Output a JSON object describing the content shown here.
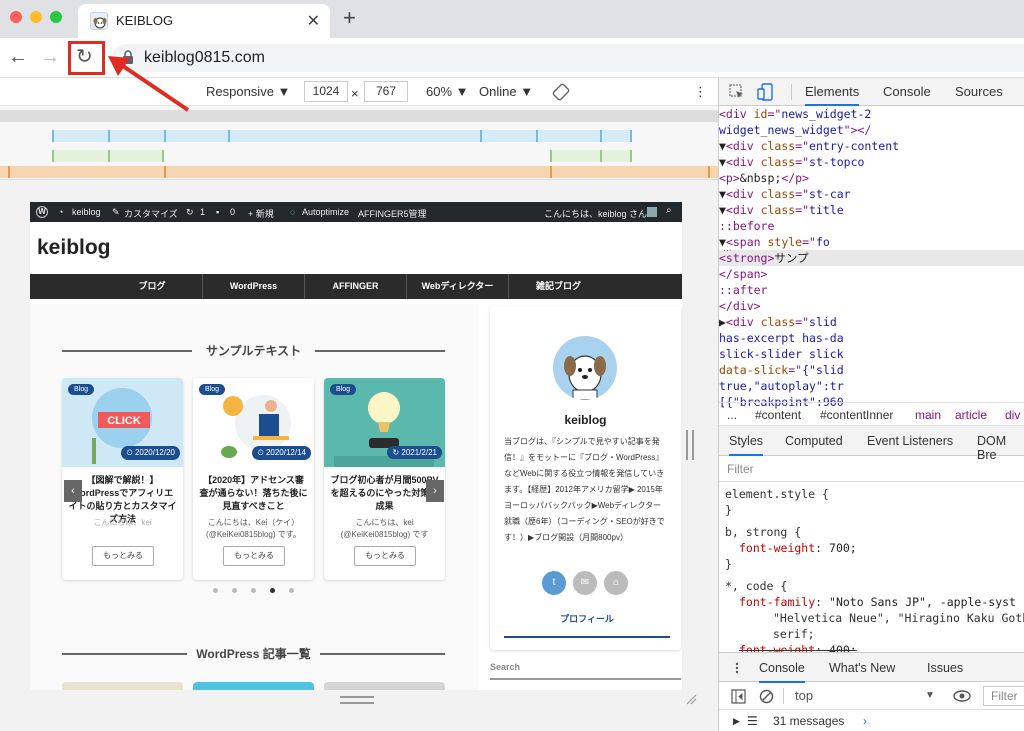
{
  "browser": {
    "tab_title": "KEIBLOG",
    "tab_close": "✕",
    "new_tab": "+",
    "back": "←",
    "forward": "→",
    "reload": "↻",
    "url": "keiblog0815.com"
  },
  "device_toolbar": {
    "mode": "Responsive ▼",
    "width": "1024",
    "times": "×",
    "height": "767",
    "zoom": "60% ▼",
    "throttle": "Online ▼",
    "more": "⋮"
  },
  "site": {
    "adminbar": {
      "wp": "W",
      "site_name": "keiblog",
      "customize": "カスタマイズ",
      "updates": "1",
      "comments": "0",
      "new": "+ 新規",
      "autoptimize": "Autoptimize",
      "affinger": "AFFINGER5管理",
      "greeting": "こんにちは、keiblog さん",
      "search": "⌕"
    },
    "logo": "keiblog",
    "menu": [
      "ブログ",
      "WordPress",
      "AFFINGER",
      "Webディレクター",
      "雑記ブログ"
    ],
    "section_title": "サンプルテキスト",
    "cards": [
      {
        "badge": "Blog",
        "date": "⏲ 2020/12/20",
        "title": "【図解で解説！】WordPressでアフィリエイトの貼り方とカスタマイズ方法",
        "excerpt": "こんにちは、kei",
        "more": "もっとみる",
        "thumb_text": "CLICK"
      },
      {
        "badge": "Blog",
        "date": "⏲ 2020/12/14",
        "title": "【2020年】アドセンス審査が通らない！落ちた後に見直すべきこと",
        "excerpt": "こんにちは、Kei（ケイ）(@KeiKei0815blog) です。",
        "more": "もっとみる"
      },
      {
        "badge": "Blog",
        "date": "↻ 2021/2/21",
        "title": "ブログ初心者が月間500PVを超えるのにやった対策・成果",
        "excerpt": "こんにちは、kei (@KeiKei0815blog) です",
        "more": "もっとみる"
      }
    ],
    "slider_prev": "‹",
    "slider_next": "›",
    "section_title_2": "WordPress 記事一覧",
    "sidebar": {
      "name": "keiblog",
      "bio": "当ブログは、『シンプルで見やすい記事を発信！』をモットーに『ブログ・WordPress』などWebに関する役立つ情報を発信していきます。【経歴】2012年アメリカ留学▶ 2015年ヨーロッパバックパック▶Webディレクター就職（歴6年）（コーディング・SEOが好きです！）▶ブログ開設（月間800pv）",
      "twitter": "t",
      "mail": "✉",
      "home": "⌂",
      "profile": "プロフィール"
    },
    "search_label": "Search"
  },
  "devtools": {
    "tabs": [
      "Elements",
      "Console",
      "Sources"
    ],
    "dom_lines": [
      {
        "indent": 155,
        "parts": [
          [
            "tg",
            "<div "
          ],
          [
            "at",
            "id"
          ],
          [
            "tg",
            "=\""
          ],
          [
            "av2",
            "news_widget-2"
          ]
        ]
      },
      {
        "indent": 155,
        "parts": [
          [
            "av2",
            "widget_news_widget"
          ],
          [
            "tg",
            "\"></"
          ]
        ]
      },
      {
        "indent": 145,
        "parts": [
          [
            "tx",
            "▼"
          ],
          [
            "tg",
            "<div "
          ],
          [
            "at",
            "class"
          ],
          [
            "tg",
            "=\""
          ],
          [
            "av2",
            "entry-content"
          ]
        ]
      },
      {
        "indent": 157,
        "parts": [
          [
            "tx",
            "▼"
          ],
          [
            "tg",
            "<div "
          ],
          [
            "at",
            "class"
          ],
          [
            "tg",
            "=\""
          ],
          [
            "av2",
            "st-topco"
          ]
        ]
      },
      {
        "indent": 188,
        "parts": [
          [
            "tg",
            "<p>"
          ],
          [
            "tx",
            "&nbsp;"
          ],
          [
            "tg",
            "</p>"
          ]
        ]
      },
      {
        "indent": 172,
        "parts": [
          [
            "tx",
            "▼"
          ],
          [
            "tg",
            "<div "
          ],
          [
            "at",
            "class"
          ],
          [
            "tg",
            "=\""
          ],
          [
            "av2",
            "st-car"
          ]
        ]
      },
      {
        "indent": 186,
        "parts": [
          [
            "tx",
            "▼"
          ],
          [
            "tg",
            "<div "
          ],
          [
            "at",
            "class"
          ],
          [
            "tg",
            "=\""
          ],
          [
            "av2",
            "title"
          ]
        ]
      },
      {
        "indent": 206,
        "parts": [
          [
            "ps",
            "::before"
          ]
        ]
      },
      {
        "indent": 196,
        "parts": [
          [
            "tx",
            "▼"
          ],
          [
            "tg",
            "<span "
          ],
          [
            "at",
            "style"
          ],
          [
            "tg",
            "=\""
          ],
          [
            "av2",
            "fo"
          ]
        ]
      },
      {
        "indent": 220,
        "parts": [
          [
            "tg",
            "<strong>"
          ],
          [
            "tx",
            "サンプ"
          ]
        ]
      },
      {
        "indent": 206,
        "parts": [
          [
            "tg",
            "</span>"
          ]
        ]
      },
      {
        "indent": 206,
        "parts": [
          [
            "ps",
            "::after"
          ]
        ]
      },
      {
        "indent": 194,
        "parts": [
          [
            "tg",
            "</div>"
          ]
        ]
      },
      {
        "indent": 182,
        "parts": [
          [
            "tx",
            "▶"
          ],
          [
            "tg",
            "<div "
          ],
          [
            "at",
            "class"
          ],
          [
            "tg",
            "=\""
          ],
          [
            "av2",
            "slid"
          ]
        ]
      },
      {
        "indent": 182,
        "parts": [
          [
            "av2",
            "has-excerpt has-da"
          ]
        ]
      },
      {
        "indent": 182,
        "parts": [
          [
            "av2",
            "slick-slider slick"
          ]
        ]
      },
      {
        "indent": 182,
        "parts": [
          [
            "at",
            "data-slick"
          ],
          [
            "tg",
            "=\""
          ],
          [
            "av2",
            "{\"slid"
          ]
        ]
      },
      {
        "indent": 182,
        "parts": [
          [
            "av2",
            "true,\"autoplay\":tr"
          ]
        ]
      },
      {
        "indent": 182,
        "parts": [
          [
            "av2",
            "[{\"breakpoint\":960"
          ]
        ]
      }
    ],
    "dom_more": "...",
    "breadcrumbs": [
      "...",
      "#content",
      "#contentInner",
      "main",
      "article",
      "div"
    ],
    "style_tabs": [
      "Styles",
      "Computed",
      "Event Listeners",
      "DOM Bre"
    ],
    "filter_placeholder": "Filter",
    "style_lines": [
      {
        "kind": "sel",
        "text": "element.style {"
      },
      {
        "kind": "sel",
        "text": "}"
      },
      {
        "kind": "sel",
        "text": "b, strong {"
      },
      {
        "kind": "prop",
        "name": "font-weight",
        "value": "700;"
      },
      {
        "kind": "sel",
        "text": "}"
      },
      {
        "kind": "sel",
        "text": "*, code {"
      },
      {
        "kind": "prop",
        "name": "font-family",
        "value": "\"Noto Sans JP\", -apple-syst"
      },
      {
        "kind": "cont",
        "text": "\"Helvetica Neue\", \"Hiragino Kaku Goth"
      },
      {
        "kind": "cont",
        "text": "serif;"
      },
      {
        "kind": "strike",
        "name": "font-weight",
        "value": "400;"
      }
    ],
    "drawer_tabs": [
      "Console",
      "What's New",
      "Issues"
    ],
    "console_context": "top",
    "console_filter": "Filter",
    "messages": "31 messages"
  }
}
